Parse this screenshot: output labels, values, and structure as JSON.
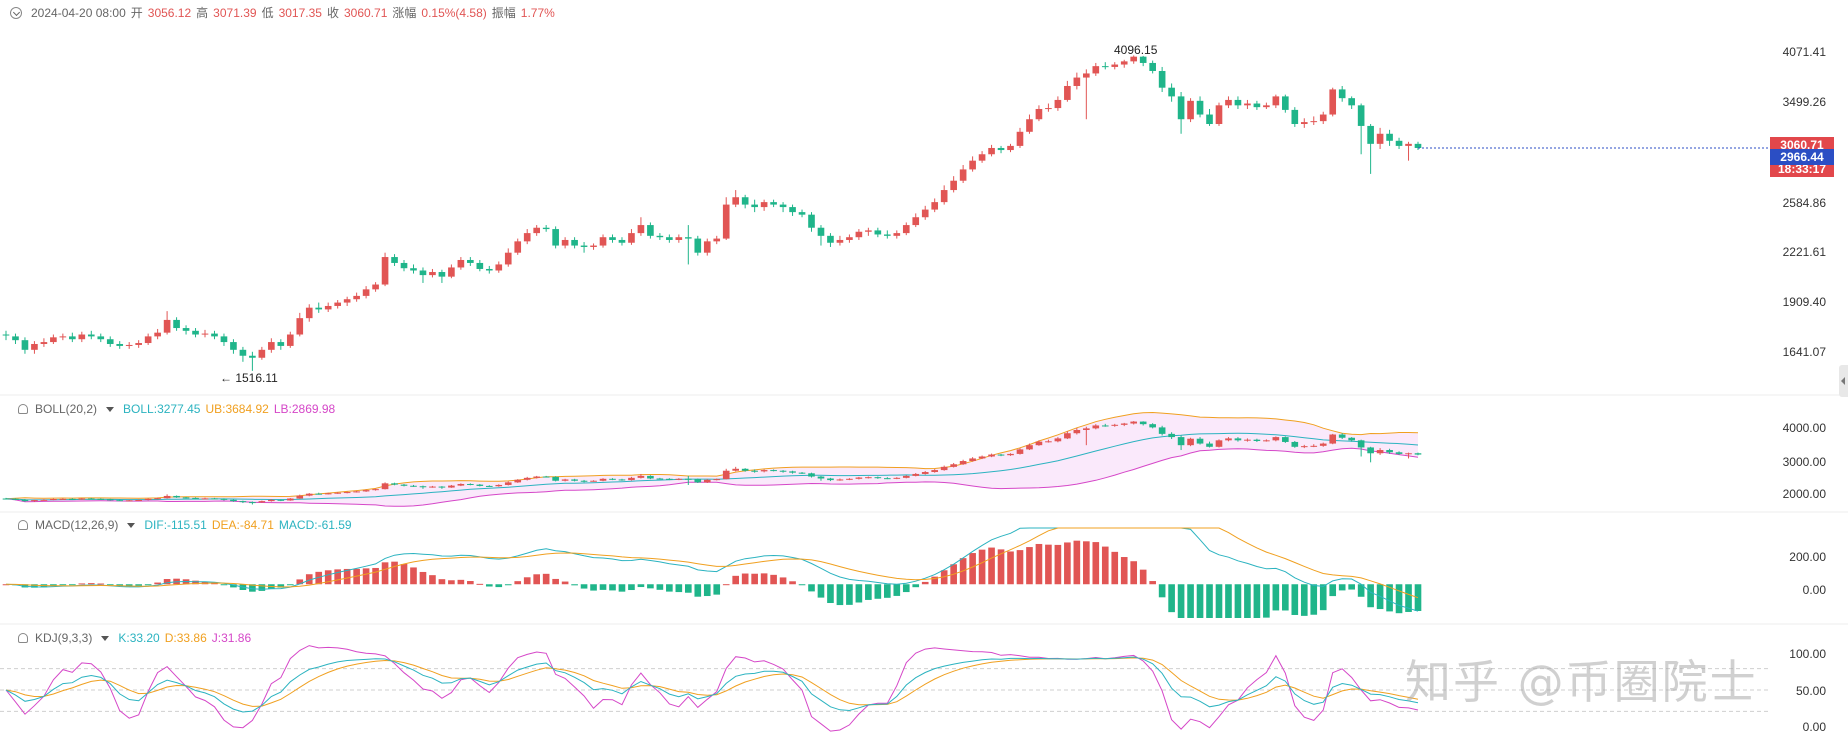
{
  "header": {
    "date": "2024-04-20 08:00",
    "open_label": "开",
    "open": "3056.12",
    "high_label": "高",
    "high": "3071.39",
    "low_label": "低",
    "low": "3017.35",
    "close_label": "收",
    "close": "3060.71",
    "change_label": "涨幅",
    "change": "0.15%(4.58)",
    "amp_label": "振幅",
    "amp": "1.77%"
  },
  "price_tags": {
    "last": "3060.71",
    "current": "2966.44",
    "countdown": "18:33:17"
  },
  "annotations": {
    "high": "4096.15",
    "low": "← 1516.11"
  },
  "boll": {
    "name": "BOLL(20,2)",
    "mid": "BOLL:3277.45",
    "ub": "UB:3684.92",
    "lb": "LB:2869.98"
  },
  "macd": {
    "name": "MACD(12,26,9)",
    "dif": "DIF:-115.51",
    "dea": "DEA:-84.71",
    "macd": "MACD:-61.59"
  },
  "kdj": {
    "name": "KDJ(9,3,3)",
    "k": "K:33.20",
    "d": "D:33.86",
    "j": "J:31.86"
  },
  "watermark": "知乎 @币圈院士",
  "colors": {
    "up": "#e15554",
    "down": "#1fb58a",
    "mid": "#2bb3c0",
    "ub": "#f0a020",
    "lb": "#d547c8",
    "tag_red": "#e2474b",
    "tag_blue": "#2b4ec4"
  },
  "chart_data": {
    "type": "candlestick",
    "price": {
      "y_ticks": [
        "4071.41",
        "3499.26",
        "2584.86",
        "2221.61",
        "1909.40",
        "1641.07"
      ],
      "ylim": [
        1450,
        4300
      ],
      "scale": "log",
      "candles": [
        [
          1700,
          1695,
          1720,
          1670
        ],
        [
          1690,
          1670,
          1705,
          1650
        ],
        [
          1670,
          1620,
          1685,
          1600
        ],
        [
          1620,
          1650,
          1665,
          1600
        ],
        [
          1650,
          1660,
          1680,
          1635
        ],
        [
          1660,
          1685,
          1700,
          1650
        ],
        [
          1685,
          1690,
          1705,
          1670
        ],
        [
          1690,
          1675,
          1710,
          1660
        ],
        [
          1675,
          1700,
          1715,
          1660
        ],
        [
          1700,
          1690,
          1720,
          1675
        ],
        [
          1690,
          1675,
          1705,
          1660
        ],
        [
          1675,
          1650,
          1690,
          1635
        ],
        [
          1650,
          1640,
          1665,
          1625
        ],
        [
          1640,
          1645,
          1660,
          1625
        ],
        [
          1645,
          1655,
          1670,
          1630
        ],
        [
          1655,
          1690,
          1705,
          1645
        ],
        [
          1690,
          1710,
          1730,
          1675
        ],
        [
          1710,
          1780,
          1830,
          1700
        ],
        [
          1780,
          1735,
          1795,
          1720
        ],
        [
          1735,
          1720,
          1750,
          1700
        ],
        [
          1720,
          1700,
          1735,
          1685
        ],
        [
          1700,
          1705,
          1725,
          1685
        ],
        [
          1705,
          1690,
          1720,
          1675
        ],
        [
          1690,
          1660,
          1705,
          1640
        ],
        [
          1660,
          1620,
          1675,
          1600
        ],
        [
          1620,
          1590,
          1635,
          1560
        ],
        [
          1590,
          1580,
          1610,
          1516
        ],
        [
          1580,
          1620,
          1635,
          1570
        ],
        [
          1620,
          1660,
          1680,
          1605
        ],
        [
          1660,
          1640,
          1675,
          1620
        ],
        [
          1640,
          1700,
          1715,
          1630
        ],
        [
          1700,
          1790,
          1820,
          1690
        ],
        [
          1790,
          1850,
          1870,
          1770
        ],
        [
          1850,
          1840,
          1880,
          1820
        ],
        [
          1840,
          1860,
          1880,
          1825
        ],
        [
          1860,
          1880,
          1895,
          1845
        ],
        [
          1880,
          1900,
          1915,
          1860
        ],
        [
          1900,
          1920,
          1940,
          1885
        ],
        [
          1920,
          1960,
          1980,
          1905
        ],
        [
          1960,
          1990,
          2005,
          1945
        ],
        [
          1990,
          2170,
          2200,
          1980
        ],
        [
          2170,
          2130,
          2190,
          2110
        ],
        [
          2130,
          2095,
          2150,
          2075
        ],
        [
          2095,
          2080,
          2120,
          2060
        ],
        [
          2080,
          2050,
          2100,
          2000
        ],
        [
          2050,
          2070,
          2090,
          2035
        ],
        [
          2070,
          2040,
          2085,
          2000
        ],
        [
          2040,
          2100,
          2120,
          2030
        ],
        [
          2100,
          2150,
          2170,
          2085
        ],
        [
          2150,
          2130,
          2170,
          2110
        ],
        [
          2130,
          2090,
          2150,
          2075
        ],
        [
          2090,
          2080,
          2110,
          2060
        ],
        [
          2080,
          2120,
          2140,
          2065
        ],
        [
          2120,
          2200,
          2230,
          2105
        ],
        [
          2200,
          2280,
          2300,
          2185
        ],
        [
          2280,
          2340,
          2370,
          2260
        ],
        [
          2340,
          2380,
          2400,
          2320
        ],
        [
          2380,
          2370,
          2400,
          2350
        ],
        [
          2370,
          2250,
          2390,
          2230
        ],
        [
          2250,
          2290,
          2310,
          2230
        ],
        [
          2290,
          2250,
          2310,
          2230
        ],
        [
          2250,
          2240,
          2275,
          2200
        ],
        [
          2240,
          2250,
          2265,
          2220
        ],
        [
          2250,
          2310,
          2330,
          2235
        ],
        [
          2310,
          2290,
          2330,
          2270
        ],
        [
          2290,
          2270,
          2310,
          2250
        ],
        [
          2270,
          2340,
          2370,
          2255
        ],
        [
          2340,
          2400,
          2460,
          2320
        ],
        [
          2400,
          2320,
          2420,
          2300
        ],
        [
          2320,
          2310,
          2340,
          2290
        ],
        [
          2310,
          2290,
          2330,
          2270
        ],
        [
          2290,
          2310,
          2330,
          2270
        ],
        [
          2310,
          2300,
          2400,
          2120
        ],
        [
          2300,
          2200,
          2320,
          2180
        ],
        [
          2200,
          2280,
          2300,
          2180
        ],
        [
          2280,
          2300,
          2320,
          2260
        ],
        [
          2300,
          2560,
          2620,
          2290
        ],
        [
          2560,
          2620,
          2680,
          2540
        ],
        [
          2620,
          2560,
          2640,
          2530
        ],
        [
          2560,
          2540,
          2600,
          2500
        ],
        [
          2540,
          2580,
          2600,
          2510
        ],
        [
          2580,
          2560,
          2600,
          2540
        ],
        [
          2560,
          2540,
          2580,
          2500
        ],
        [
          2540,
          2500,
          2560,
          2470
        ],
        [
          2500,
          2480,
          2520,
          2460
        ],
        [
          2480,
          2380,
          2500,
          2350
        ],
        [
          2380,
          2320,
          2400,
          2250
        ],
        [
          2320,
          2270,
          2340,
          2240
        ],
        [
          2270,
          2290,
          2320,
          2250
        ],
        [
          2290,
          2310,
          2330,
          2270
        ],
        [
          2310,
          2350,
          2370,
          2290
        ],
        [
          2350,
          2360,
          2380,
          2320
        ],
        [
          2360,
          2330,
          2380,
          2310
        ],
        [
          2330,
          2320,
          2360,
          2300
        ],
        [
          2320,
          2340,
          2360,
          2300
        ],
        [
          2340,
          2400,
          2420,
          2325
        ],
        [
          2400,
          2460,
          2490,
          2385
        ],
        [
          2460,
          2520,
          2550,
          2440
        ],
        [
          2520,
          2580,
          2610,
          2500
        ],
        [
          2580,
          2680,
          2720,
          2560
        ],
        [
          2680,
          2760,
          2800,
          2660
        ],
        [
          2760,
          2860,
          2900,
          2740
        ],
        [
          2860,
          2940,
          2980,
          2840
        ],
        [
          2940,
          3000,
          3030,
          2920
        ],
        [
          3000,
          3060,
          3090,
          2980
        ],
        [
          3060,
          3040,
          3080,
          3010
        ],
        [
          3040,
          3080,
          3100,
          3020
        ],
        [
          3080,
          3220,
          3260,
          3060
        ],
        [
          3220,
          3350,
          3400,
          3200
        ],
        [
          3350,
          3460,
          3500,
          3330
        ],
        [
          3460,
          3470,
          3520,
          3430
        ],
        [
          3470,
          3560,
          3600,
          3440
        ],
        [
          3560,
          3720,
          3780,
          3540
        ],
        [
          3720,
          3820,
          3880,
          3680
        ],
        [
          3820,
          3870,
          3920,
          3350
        ],
        [
          3870,
          3960,
          4000,
          3840
        ],
        [
          3960,
          3950,
          4010,
          3920
        ],
        [
          3950,
          3980,
          4010,
          3920
        ],
        [
          3980,
          4020,
          4040,
          3940
        ],
        [
          4020,
          4080,
          4096,
          3990
        ],
        [
          4080,
          4000,
          4090,
          3960
        ],
        [
          4000,
          3900,
          4030,
          3870
        ],
        [
          3900,
          3700,
          3950,
          3650
        ],
        [
          3700,
          3600,
          3750,
          3540
        ],
        [
          3600,
          3350,
          3650,
          3200
        ],
        [
          3350,
          3550,
          3580,
          3320
        ],
        [
          3550,
          3400,
          3600,
          3370
        ],
        [
          3400,
          3300,
          3460,
          3280
        ],
        [
          3300,
          3500,
          3530,
          3280
        ],
        [
          3500,
          3560,
          3600,
          3470
        ],
        [
          3560,
          3500,
          3600,
          3460
        ],
        [
          3500,
          3520,
          3560,
          3460
        ],
        [
          3520,
          3480,
          3550,
          3450
        ],
        [
          3480,
          3500,
          3530,
          3460
        ],
        [
          3500,
          3600,
          3620,
          3470
        ],
        [
          3600,
          3450,
          3620,
          3420
        ],
        [
          3450,
          3300,
          3480,
          3270
        ],
        [
          3300,
          3320,
          3360,
          3260
        ],
        [
          3320,
          3330,
          3380,
          3290
        ],
        [
          3330,
          3400,
          3430,
          3300
        ],
        [
          3400,
          3680,
          3700,
          3380
        ],
        [
          3680,
          3580,
          3720,
          3540
        ],
        [
          3580,
          3500,
          3600,
          3460
        ],
        [
          3500,
          3280,
          3520,
          3000
        ],
        [
          3280,
          3100,
          3300,
          2820
        ],
        [
          3100,
          3200,
          3260,
          3050
        ],
        [
          3200,
          3130,
          3240,
          3080
        ],
        [
          3130,
          3080,
          3160,
          3050
        ],
        [
          3080,
          3100,
          3120,
          2940
        ],
        [
          3100,
          3060,
          3120,
          3040
        ]
      ]
    },
    "boll": {
      "y_ticks": [
        "4000.00",
        "3000.00",
        "2000.00"
      ],
      "ylim": [
        1500,
        4500
      ]
    },
    "macd": {
      "y_ticks": [
        "200.00",
        "0.00"
      ],
      "ylim": [
        -120,
        200
      ]
    },
    "kdj": {
      "y_ticks": [
        "100.00",
        "50.00",
        "0.00"
      ],
      "ylim": [
        -20,
        120
      ]
    }
  }
}
